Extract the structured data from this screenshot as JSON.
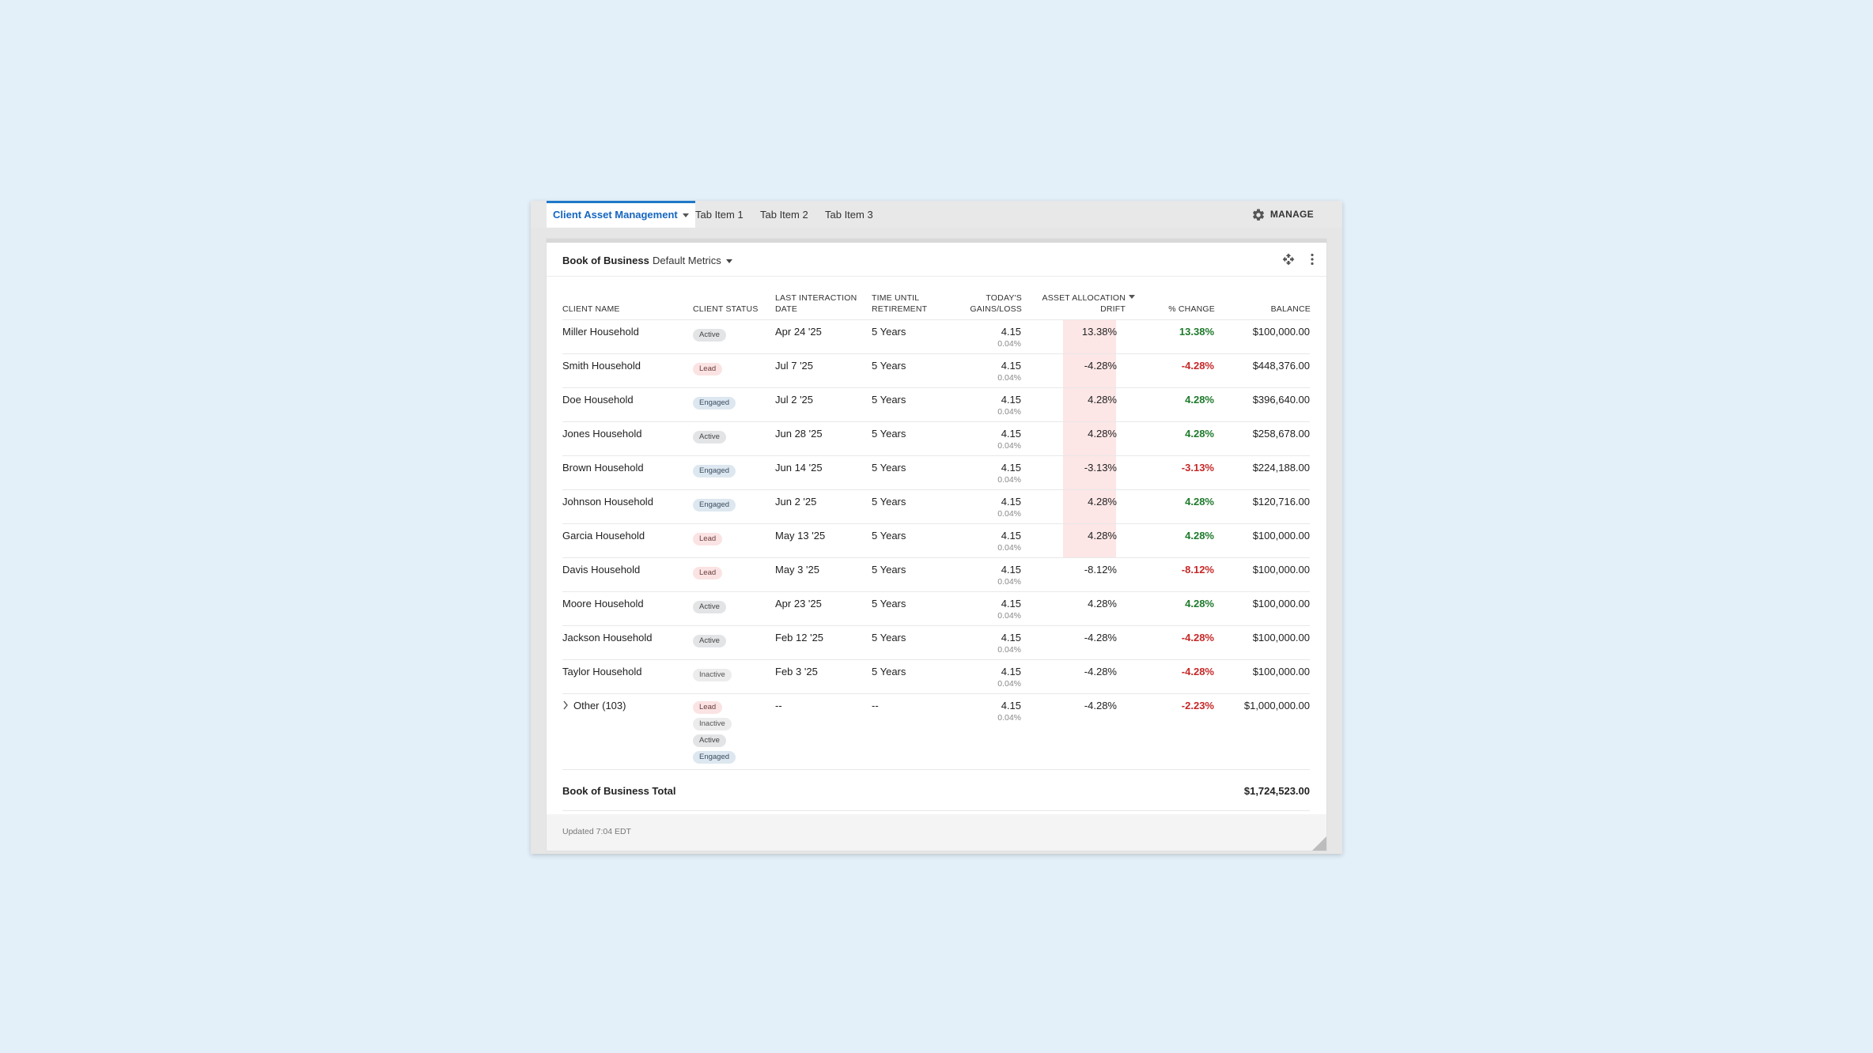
{
  "tabs": [
    {
      "label": "Client Asset Management",
      "active": true
    },
    {
      "label": "Tab Item 1"
    },
    {
      "label": "Tab Item 2"
    },
    {
      "label": "Tab Item 3"
    }
  ],
  "manage_label": "MANAGE",
  "card": {
    "title": "Book of Business",
    "metrics_label": "Default Metrics"
  },
  "columns": {
    "client_name": "CLIENT NAME",
    "client_status": "CLIENT STATUS",
    "last_interaction_1": "LAST INTERACTION",
    "last_interaction_2": "DATE",
    "time_until_1": "TIME UNTIL",
    "time_until_2": "RETIREMENT",
    "gains_1": "TODAY'S",
    "gains_2": "GAINS/LOSS",
    "drift_1": "ASSET ALLOCATION",
    "drift_2": "DRIFT",
    "pct_change": "% CHANGE",
    "balance": "BALANCE"
  },
  "rows": [
    {
      "name": "Miller Household",
      "status": [
        "Active"
      ],
      "date": "Apr 24 '25",
      "retire": "5 Years",
      "gain": "4.15",
      "gain_pct": "0.04%",
      "drift": "13.38%",
      "change": "13.38%",
      "balance": "$100,000.00"
    },
    {
      "name": "Smith Household",
      "status": [
        "Lead"
      ],
      "date": "Jul 7 '25",
      "retire": "5 Years",
      "gain": "4.15",
      "gain_pct": "0.04%",
      "drift": "-4.28%",
      "change": "-4.28%",
      "balance": "$448,376.00"
    },
    {
      "name": "Doe Household",
      "status": [
        "Engaged"
      ],
      "date": "Jul 2 '25",
      "retire": "5 Years",
      "gain": "4.15",
      "gain_pct": "0.04%",
      "drift": "4.28%",
      "change": "4.28%",
      "balance": "$396,640.00"
    },
    {
      "name": "Jones Household",
      "status": [
        "Active"
      ],
      "date": "Jun 28 '25",
      "retire": "5 Years",
      "gain": "4.15",
      "gain_pct": "0.04%",
      "drift": "4.28%",
      "change": "4.28%",
      "balance": "$258,678.00"
    },
    {
      "name": "Brown Household",
      "status": [
        "Engaged"
      ],
      "date": "Jun 14 '25",
      "retire": "5 Years",
      "gain": "4.15",
      "gain_pct": "0.04%",
      "drift": "-3.13%",
      "change": "-3.13%",
      "balance": "$224,188.00"
    },
    {
      "name": "Johnson Household",
      "status": [
        "Engaged"
      ],
      "date": "Jun 2 '25",
      "retire": "5 Years",
      "gain": "4.15",
      "gain_pct": "0.04%",
      "drift": "4.28%",
      "change": "4.28%",
      "balance": "$120,716.00"
    },
    {
      "name": "Garcia Household",
      "status": [
        "Lead"
      ],
      "date": "May 13 '25",
      "retire": "5 Years",
      "gain": "4.15",
      "gain_pct": "0.04%",
      "drift": "4.28%",
      "change": "4.28%",
      "balance": "$100,000.00"
    },
    {
      "name": "Davis Household",
      "status": [
        "Lead"
      ],
      "date": "May 3 '25",
      "retire": "5 Years",
      "gain": "4.15",
      "gain_pct": "0.04%",
      "drift": "-8.12%",
      "change": "-8.12%",
      "balance": "$100,000.00"
    },
    {
      "name": "Moore Household",
      "status": [
        "Active"
      ],
      "date": "Apr 23 '25",
      "retire": "5 Years",
      "gain": "4.15",
      "gain_pct": "0.04%",
      "drift": "4.28%",
      "change": "4.28%",
      "balance": "$100,000.00"
    },
    {
      "name": "Jackson Household",
      "status": [
        "Active"
      ],
      "date": "Feb 12 '25",
      "retire": "5 Years",
      "gain": "4.15",
      "gain_pct": "0.04%",
      "drift": "-4.28%",
      "change": "-4.28%",
      "balance": "$100,000.00"
    },
    {
      "name": "Taylor Household",
      "status": [
        "Inactive"
      ],
      "date": "Feb 3 '25",
      "retire": "5 Years",
      "gain": "4.15",
      "gain_pct": "0.04%",
      "drift": "-4.28%",
      "change": "-4.28%",
      "balance": "$100,000.00"
    },
    {
      "name": "Other (103)",
      "expandable": true,
      "status": [
        "Lead",
        "Inactive",
        "Active",
        "Engaged"
      ],
      "date": "--",
      "retire": "--",
      "gain": "4.15",
      "gain_pct": "0.04%",
      "drift": "-4.28%",
      "change": "-2.23%",
      "balance": "$1,000,000.00"
    }
  ],
  "highlighted_drift_rows": 7,
  "total": {
    "label": "Book of Business Total",
    "value": "$1,724,523.00"
  },
  "updated": "Updated 7:04 EDT",
  "colors": {
    "accent": "#1f78c8",
    "positive": "#1e7a2b",
    "negative": "#c62828",
    "drift_highlight": "#fde6e6"
  }
}
